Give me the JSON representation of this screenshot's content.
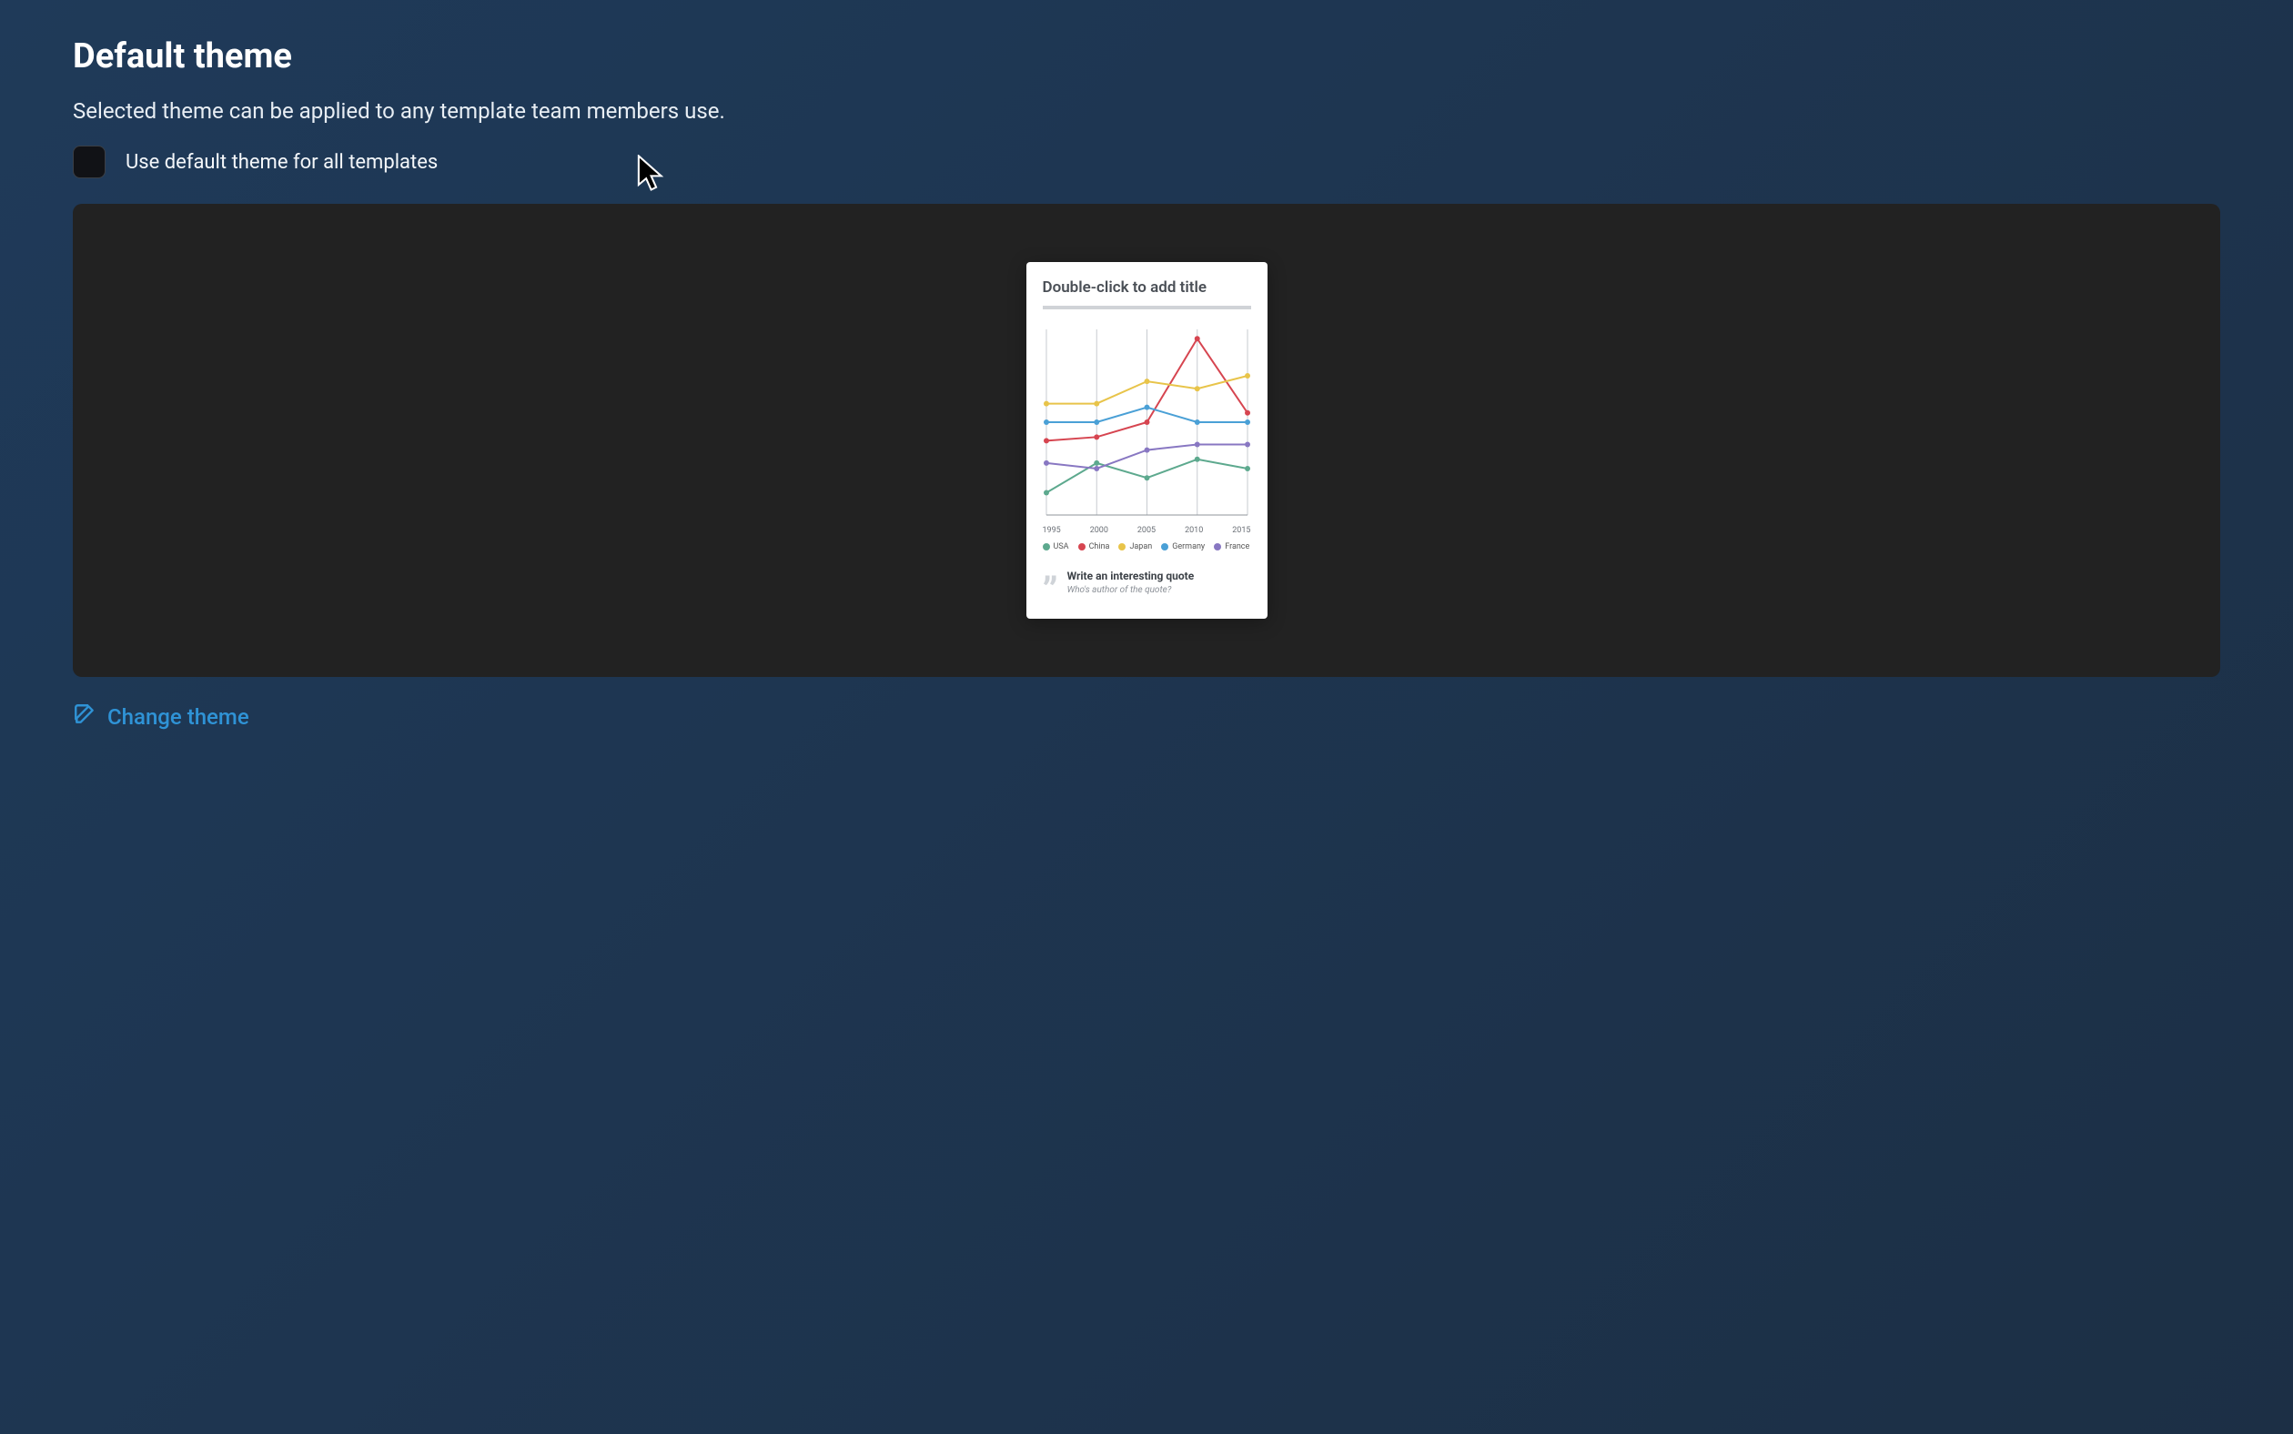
{
  "header": {
    "title": "Default theme",
    "subtitle": "Selected theme can be applied to any template team members use."
  },
  "checkbox": {
    "label": "Use default theme for all templates",
    "checked": false
  },
  "preview": {
    "title_placeholder": "Double-click to add title",
    "quote": {
      "text": "Write an interesting quote",
      "author": "Who's author of the quote?"
    }
  },
  "actions": {
    "change_theme": "Change theme"
  },
  "colors": {
    "usa": "#5da98e",
    "china": "#d64550",
    "japan": "#e8c44a",
    "germany": "#4aa0d6",
    "france": "#8877c2"
  },
  "chart_data": {
    "type": "line",
    "title": "",
    "xlabel": "",
    "ylabel": "",
    "categories": [
      "1995",
      "2000",
      "2005",
      "2010",
      "2015"
    ],
    "series": [
      {
        "name": "USA",
        "color": "#5da98e",
        "values": [
          12,
          28,
          20,
          30,
          25
        ]
      },
      {
        "name": "China",
        "color": "#d64550",
        "values": [
          40,
          42,
          50,
          95,
          55
        ]
      },
      {
        "name": "Japan",
        "color": "#e8c44a",
        "values": [
          60,
          60,
          72,
          68,
          75
        ]
      },
      {
        "name": "Germany",
        "color": "#4aa0d6",
        "values": [
          50,
          50,
          58,
          50,
          50
        ]
      },
      {
        "name": "France",
        "color": "#8877c2",
        "values": [
          28,
          25,
          35,
          38,
          38
        ]
      }
    ],
    "ylim": [
      0,
      100
    ],
    "grid": true
  }
}
